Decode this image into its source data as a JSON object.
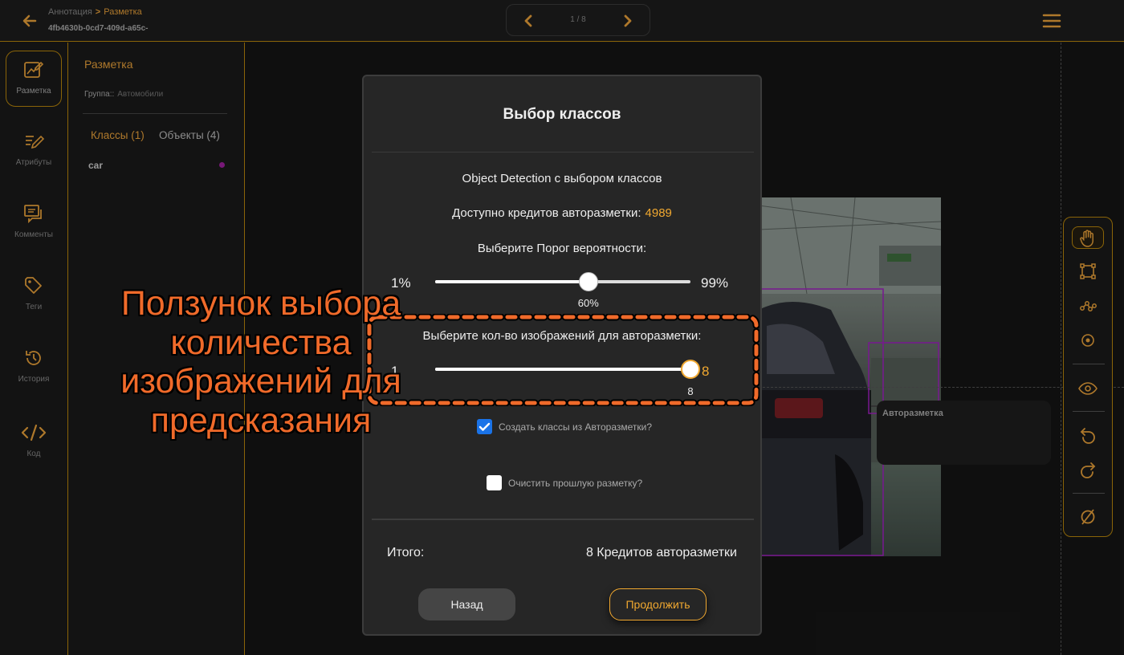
{
  "header": {
    "breadcrumb_parent": "Аннотация",
    "breadcrumb_separator": ">",
    "breadcrumb_current": "Разметка",
    "doc_id": "4fb4630b-0cd7-409d-a65c-",
    "pager_text": "1 / 8",
    "colors": {
      "accent": "#e8a13a",
      "divider": "#b8860b"
    }
  },
  "rail": {
    "items": [
      {
        "label": "Разметка",
        "icon": "edit-image-icon",
        "active": true
      },
      {
        "label": "Атрибуты",
        "icon": "pen-lines-icon"
      },
      {
        "label": "Комменты",
        "icon": "comments-icon"
      },
      {
        "label": "Теги",
        "icon": "tag-icon"
      },
      {
        "label": "История",
        "icon": "history-icon"
      },
      {
        "label": "Код",
        "icon": "code-icon"
      }
    ]
  },
  "panel": {
    "title": "Разметка",
    "group_label": "Группа::",
    "group_value": "Автомобили",
    "tab_classes": "Классы (1)",
    "tab_objects": "Объекты (4)",
    "classes": [
      {
        "name": "car",
        "color": "#a020a0"
      }
    ]
  },
  "canvas": {
    "auto_panel_title": "Авторазметка"
  },
  "toolbar": {
    "tools": [
      "hand-icon",
      "bbox-icon",
      "polyline-icon",
      "point-icon",
      "eye-icon",
      "undo-icon",
      "redo-icon",
      "clear-icon"
    ]
  },
  "modal": {
    "title": "Выбор классов",
    "subtitle": "Object Detection с выбором классов",
    "credits_label": "Доступно кредитов авторазметки:",
    "credits_value": "4989",
    "threshold_label": "Выберите Порог вероятности:",
    "threshold_min": "1%",
    "threshold_max": "99%",
    "threshold_value": "60%",
    "threshold_fraction": 0.6,
    "count_label": "Выберите кол-во изображений для авторазметки:",
    "count_min": "1",
    "count_max": "8",
    "count_value": "8",
    "count_fraction": 1.0,
    "create_classes_label": "Создать классы из Авторазметки?",
    "create_classes_checked": true,
    "clear_label": "Очистить прошлую разметку?",
    "clear_checked": false,
    "total_label": "Итого:",
    "total_value": "8 Кредитов авторазметки",
    "back_label": "Назад",
    "continue_label": "Продолжить"
  },
  "annotation": {
    "text": "Ползунок выбора количества изображений для предсказания",
    "color": "#f06a2a"
  }
}
